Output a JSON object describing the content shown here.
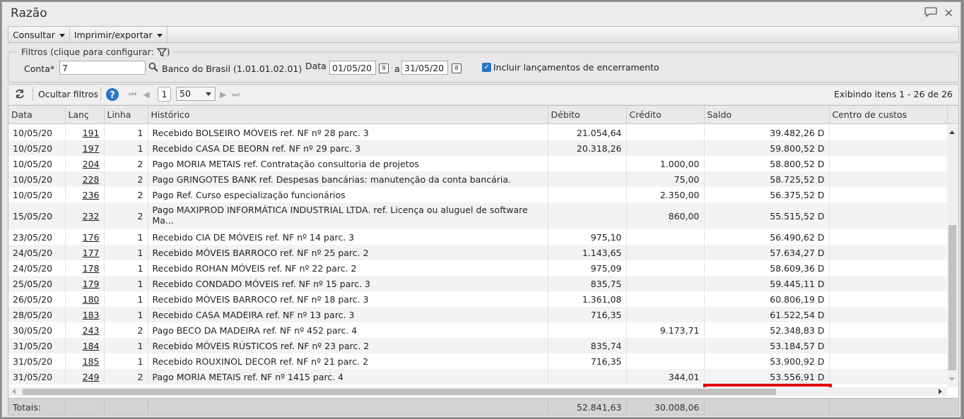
{
  "window": {
    "title": "Razão"
  },
  "menu": {
    "consultar": "Consultar",
    "imprimir": "Imprimir/exportar"
  },
  "filters": {
    "legend": "Filtros (clique para configurar:",
    "legend_close": ")",
    "conta_label": "Conta*",
    "conta_value": "7",
    "conta_desc": "Banco do Brasil (1.01.01.02.01)",
    "data_label": "Data",
    "date_from": "01/05/20",
    "a_label": "a",
    "date_to": "31/05/20",
    "include_label": "Incluir lançamentos de encerramento",
    "include_checked": true
  },
  "toolbar": {
    "hide_filters": "Ocultar filtros",
    "page": "1",
    "page_size": "50",
    "status": "Exibindo itens 1 - 26 de 26"
  },
  "columns": [
    "Data",
    "Lanç",
    "Linha",
    "Histórico",
    "Débito",
    "Crédito",
    "Saldo",
    "Centro de custos"
  ],
  "rows": [
    {
      "data": "10/05/20",
      "lanc": "191",
      "linha": "1",
      "historico": "Recebido BOLSEIRO MÓVEIS ref. NF nº 28 parc. 3",
      "debito": "21.054,64",
      "credito": "",
      "saldo": "39.482,26 D",
      "centro": ""
    },
    {
      "data": "10/05/20",
      "lanc": "197",
      "linha": "1",
      "historico": "Recebido CASA DE BEORN ref. NF nº 29 parc. 3",
      "debito": "20.318,26",
      "credito": "",
      "saldo": "59.800,52 D",
      "centro": ""
    },
    {
      "data": "10/05/20",
      "lanc": "204",
      "linha": "2",
      "historico": "Pago MORIA METAIS ref. Contratação consultoria de projetos",
      "debito": "",
      "credito": "1.000,00",
      "saldo": "58.800,52 D",
      "centro": ""
    },
    {
      "data": "10/05/20",
      "lanc": "228",
      "linha": "2",
      "historico": "Pago GRINGOTES BANK ref. Despesas bancárias: manutenção da conta bancária.",
      "debito": "",
      "credito": "75,00",
      "saldo": "58.725,52 D",
      "centro": ""
    },
    {
      "data": "10/05/20",
      "lanc": "236",
      "linha": "2",
      "historico": "Pago Ref. Curso especialização funcionários",
      "debito": "",
      "credito": "2.350,00",
      "saldo": "56.375,52 D",
      "centro": ""
    },
    {
      "data": "15/05/20",
      "lanc": "232",
      "linha": "2",
      "historico": "Pago MAXIPROD INFORMÁTICA INDUSTRIAL LTDA. ref. Licença ou aluguel de software Ma...",
      "debito": "",
      "credito": "860,00",
      "saldo": "55.515,52 D",
      "centro": "",
      "tall": true
    },
    {
      "data": "23/05/20",
      "lanc": "176",
      "linha": "1",
      "historico": "Recebido CIA DE MÓVEIS ref. NF nº 14 parc. 3",
      "debito": "975,10",
      "credito": "",
      "saldo": "56.490,62 D",
      "centro": ""
    },
    {
      "data": "24/05/20",
      "lanc": "177",
      "linha": "1",
      "historico": "Recebido MÓVEIS BARROCO ref. NF nº 25 parc. 2",
      "debito": "1.143,65",
      "credito": "",
      "saldo": "57.634,27 D",
      "centro": ""
    },
    {
      "data": "24/05/20",
      "lanc": "178",
      "linha": "1",
      "historico": "Recebido ROHAN MÓVEIS ref. NF nº 22 parc. 2",
      "debito": "975,09",
      "credito": "",
      "saldo": "58.609,36 D",
      "centro": ""
    },
    {
      "data": "25/05/20",
      "lanc": "179",
      "linha": "1",
      "historico": "Recebido CONDADO MÓVEIS ref. NF nº 15 parc. 3",
      "debito": "835,75",
      "credito": "",
      "saldo": "59.445,11 D",
      "centro": ""
    },
    {
      "data": "26/05/20",
      "lanc": "180",
      "linha": "1",
      "historico": "Recebido MÓVEIS BARROCO ref. NF nº 18 parc. 3",
      "debito": "1.361,08",
      "credito": "",
      "saldo": "60.806,19 D",
      "centro": ""
    },
    {
      "data": "28/05/20",
      "lanc": "183",
      "linha": "1",
      "historico": "Recebido CASA MADEIRA ref. NF nº 13 parc. 3",
      "debito": "716,35",
      "credito": "",
      "saldo": "61.522,54 D",
      "centro": ""
    },
    {
      "data": "30/05/20",
      "lanc": "243",
      "linha": "2",
      "historico": "Pago BECO DA MADEIRA ref. NF nº 452 parc. 4",
      "debito": "",
      "credito": "9.173,71",
      "saldo": "52.348,83 D",
      "centro": ""
    },
    {
      "data": "31/05/20",
      "lanc": "184",
      "linha": "1",
      "historico": "Recebido MÓVEIS RÚSTICOS ref. NF nº 23 parc. 2",
      "debito": "835,74",
      "credito": "",
      "saldo": "53.184,57 D",
      "centro": ""
    },
    {
      "data": "31/05/20",
      "lanc": "185",
      "linha": "1",
      "historico": "Recebido ROUXINOL DECOR ref. NF nº 21 parc. 2",
      "debito": "716,35",
      "credito": "",
      "saldo": "53.900,92 D",
      "centro": ""
    },
    {
      "data": "31/05/20",
      "lanc": "249",
      "linha": "2",
      "historico": "Pago MORIA METAIS ref. NF nº 1415 parc. 4",
      "debito": "",
      "credito": "344,01",
      "saldo": "53.556,91 D",
      "centro": ""
    }
  ],
  "totals": {
    "label": "Totais:",
    "debito": "52.841,63",
    "credito": "30.008,06"
  },
  "colors": {
    "highlight": "#e00000",
    "checkbox": "#2a76c6",
    "help": "#2a76c6"
  }
}
